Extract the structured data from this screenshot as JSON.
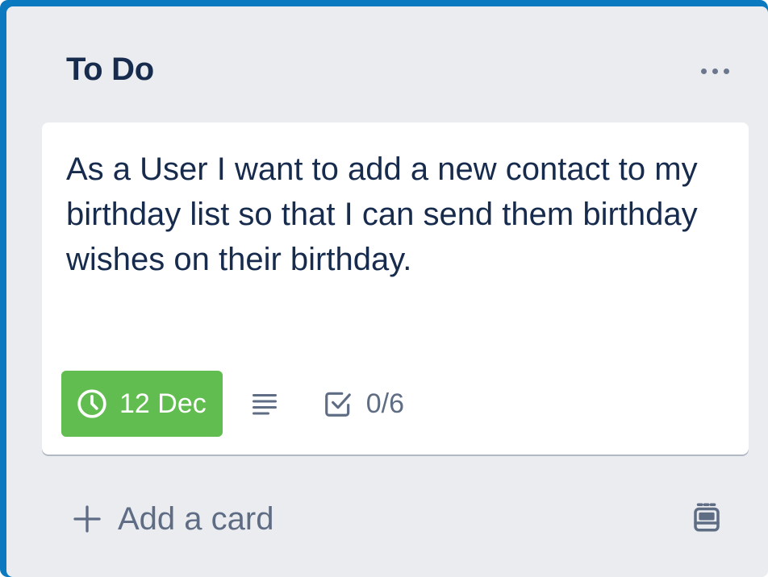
{
  "list": {
    "title": "To Do",
    "more_icon": "ellipsis-icon"
  },
  "card": {
    "title": "As a User I want to add a new contact to my birthday list so that I can send them birthday wishes on their birthday.",
    "due": {
      "icon": "clock-icon",
      "label": "12 Dec",
      "color": "#61bd4f"
    },
    "description_icon": "description-icon",
    "checklist": {
      "icon": "checkbox-icon",
      "label": "0/6"
    }
  },
  "composer": {
    "add_label": "Add a card",
    "add_icon": "plus-icon",
    "template_icon": "card-template-icon"
  },
  "colors": {
    "frame": "#0a79bf",
    "list_bg": "#ebecf0",
    "text": "#172b4d",
    "muted": "#5e6c84"
  }
}
